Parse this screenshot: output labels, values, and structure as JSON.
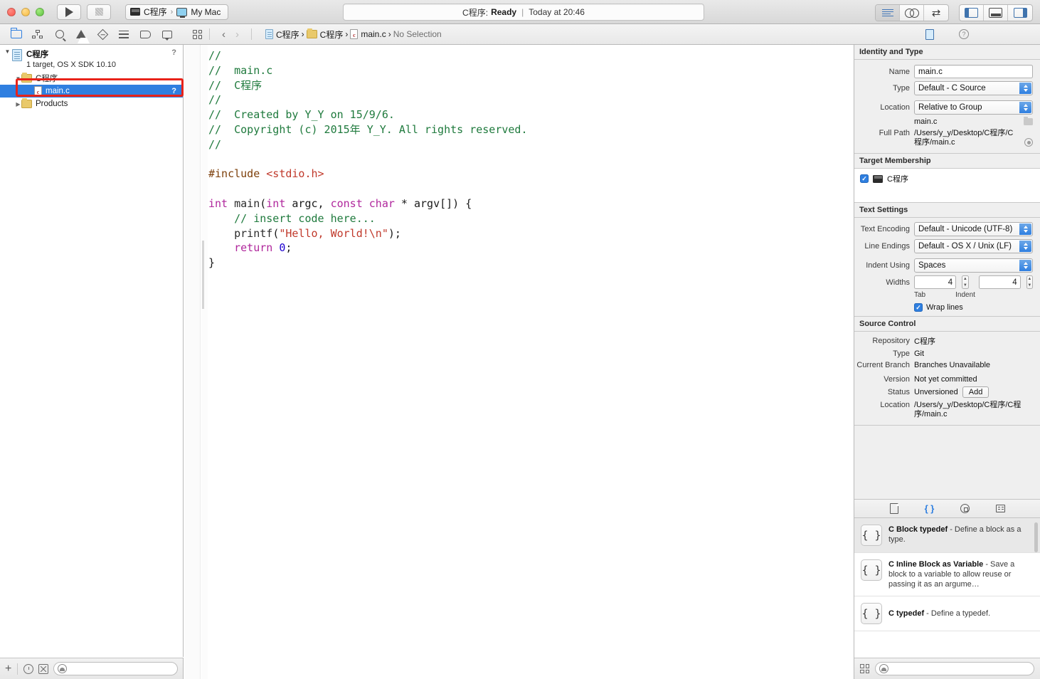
{
  "window": {
    "status_project": "C程序:",
    "status_state": "Ready",
    "status_separator": "|",
    "status_time": "Today at 20:46"
  },
  "toolbar": {
    "run_label": "run-button",
    "stop_label": "stop-button",
    "scheme_target": "C程序",
    "scheme_arrow": "›",
    "scheme_destination": "My Mac"
  },
  "navigator_tabs": [
    {
      "name": "project-navigator",
      "label": "Project"
    },
    {
      "name": "symbol-navigator",
      "label": "Symbol"
    },
    {
      "name": "find-navigator",
      "label": "Find"
    },
    {
      "name": "issue-navigator",
      "label": "Issue"
    },
    {
      "name": "test-navigator",
      "label": "Test"
    },
    {
      "name": "debug-navigator",
      "label": "Debug"
    },
    {
      "name": "breakpoint-navigator",
      "label": "Breakpoint"
    },
    {
      "name": "report-navigator",
      "label": "Report"
    }
  ],
  "navigator": {
    "project_name": "C程序",
    "project_subtitle": "1 target, OS X SDK 10.10",
    "project_badge": "?",
    "group_name": "C程序",
    "file_name": "main.c",
    "file_badge": "?",
    "products_name": "Products",
    "filter_placeholder": ""
  },
  "jumpbar": {
    "back": "‹",
    "forward": "›",
    "crumb_project": "C程序",
    "crumb_group": "C程序",
    "crumb_file": "main.c",
    "crumb_selection": "No Selection",
    "sep": "›"
  },
  "editor": {
    "lines": [
      "//",
      "//  main.c",
      "//  C程序",
      "//",
      "//  Created by Y_Y on 15/9/6.",
      "//  Copyright (c) 2015年 Y_Y. All rights reserved.",
      "//",
      "",
      "#include <stdio.h>",
      "",
      "int main(int argc, const char * argv[]) {",
      "    // insert code here...",
      "    printf(\"Hello, World!\\n\");",
      "    return 0;",
      "}"
    ],
    "colors": {
      "comment": "#1f7a3d",
      "keyword": "#b0279c",
      "string": "#c0392b",
      "preprocessor": "#7d3f0a",
      "number": "#1c00cf"
    }
  },
  "inspector": {
    "tabs": [
      {
        "name": "file-inspector",
        "label": "File inspector",
        "active": true
      },
      {
        "name": "quick-help-inspector",
        "label": "Quick Help",
        "active": false
      }
    ],
    "identity": {
      "heading": "Identity and Type",
      "name_label": "Name",
      "name_value": "main.c",
      "type_label": "Type",
      "type_value": "Default - C Source",
      "location_label": "Location",
      "location_value": "Relative to Group",
      "location_file": "main.c",
      "fullpath_label": "Full Path",
      "fullpath_value": "/Users/y_y/Desktop/C程序/C程序/main.c"
    },
    "target_membership": {
      "heading": "Target Membership",
      "target_name": "C程序",
      "checked": true
    },
    "text_settings": {
      "heading": "Text Settings",
      "encoding_label": "Text Encoding",
      "encoding_value": "Default - Unicode (UTF-8)",
      "endings_label": "Line Endings",
      "endings_value": "Default - OS X / Unix (LF)",
      "indent_label": "Indent Using",
      "indent_value": "Spaces",
      "widths_label": "Widths",
      "tab_width": "4",
      "indent_width": "4",
      "tab_caption": "Tab",
      "indent_caption": "Indent",
      "wrap_label": "Wrap lines",
      "wrap_checked": true
    },
    "source_control": {
      "heading": "Source Control",
      "repository_label": "Repository",
      "repository_value": "C程序",
      "type_label": "Type",
      "type_value": "Git",
      "branch_label": "Current Branch",
      "branch_value": "Branches Unavailable",
      "version_label": "Version",
      "version_value": "Not yet committed",
      "status_label": "Status",
      "status_value": "Unversioned",
      "add_button": "Add",
      "location_label": "Location",
      "location_value": "/Users/y_y/Desktop/C程序/C程序/main.c"
    }
  },
  "library": {
    "tabs": [
      {
        "name": "file-template-library",
        "glyph": "⎓",
        "active": false
      },
      {
        "name": "code-snippet-library",
        "glyph": "{ }",
        "active": true
      },
      {
        "name": "object-library",
        "glyph": "◉",
        "active": false
      },
      {
        "name": "media-library",
        "glyph": "☷",
        "active": false
      }
    ],
    "snippets": [
      {
        "icon": "{ }",
        "title": "C Block typedef",
        "description": " - Define a block as a type.",
        "selected": true
      },
      {
        "icon": "{ }",
        "title": "C Inline Block as Variable",
        "description": " - Save a block to a variable to allow reuse or passing it as an argume…",
        "selected": false
      },
      {
        "icon": "{ }",
        "title": "C typedef",
        "description": " - Define a typedef.",
        "selected": false
      }
    ],
    "filter_placeholder": ""
  },
  "annotation": {
    "color": "#e8231a",
    "target": "main.c"
  }
}
